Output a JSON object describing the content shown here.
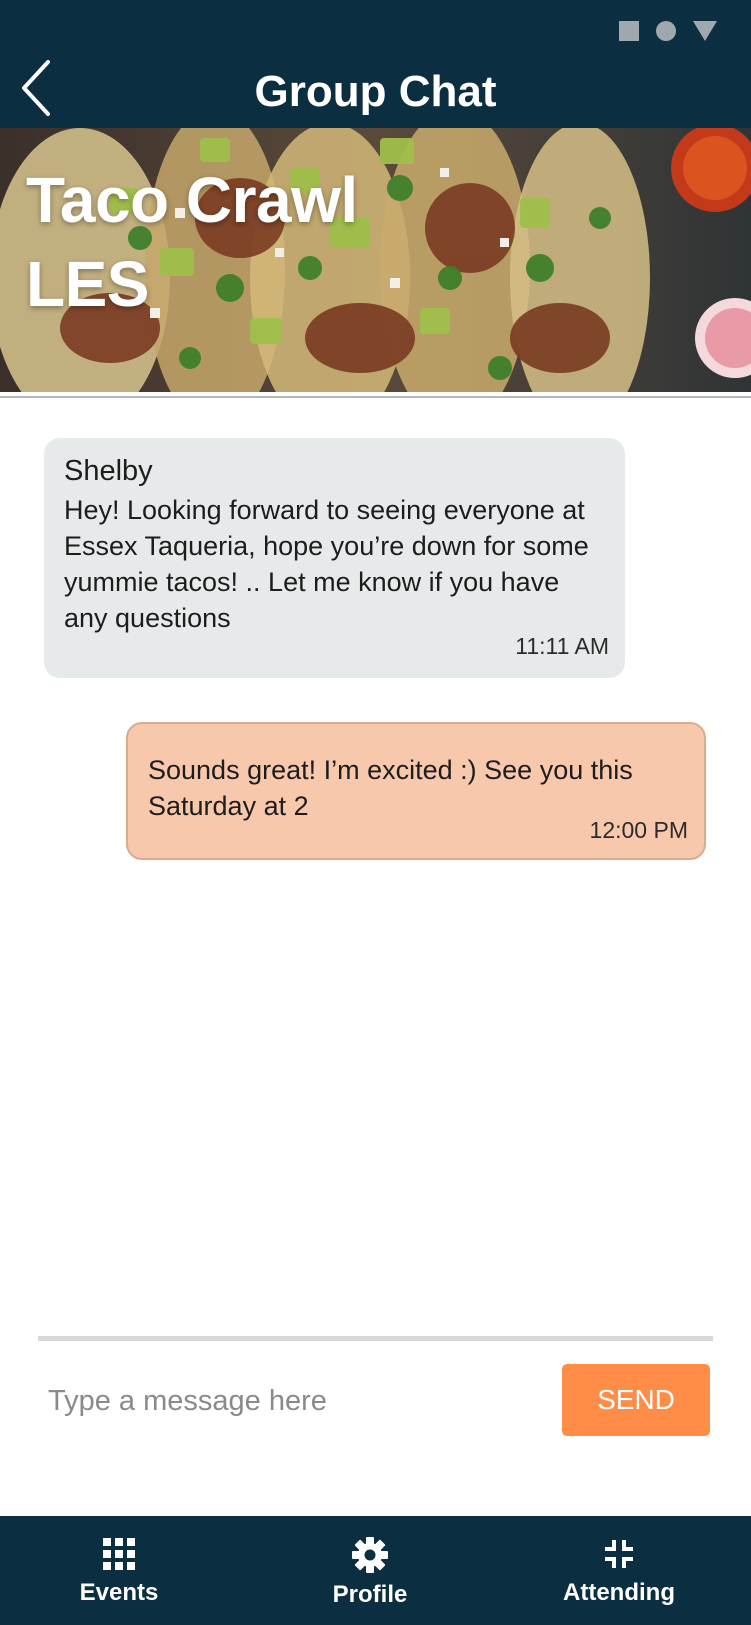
{
  "header": {
    "title": "Group Chat",
    "back_icon": "chevron-left-icon",
    "status_icons": [
      "square-icon",
      "circle-icon",
      "triangle-down-icon"
    ]
  },
  "event": {
    "title": "Taco Crawl LES"
  },
  "messages": [
    {
      "direction": "incoming",
      "sender": "Shelby",
      "text": "Hey! Looking forward to seeing everyone at Essex Taqueria, hope you’re down for some yummie tacos! ..  Let me know if you have any questions",
      "time": "11:11 AM"
    },
    {
      "direction": "outgoing",
      "text": "Sounds great! I’m excited :) See you this Saturday at 2",
      "time": "12:00 PM"
    }
  ],
  "composer": {
    "placeholder": "Type a message here",
    "send_label": "SEND"
  },
  "nav": {
    "items": [
      {
        "label": "Events",
        "icon": "grid-icon"
      },
      {
        "label": "Profile",
        "icon": "gear-icon"
      },
      {
        "label": "Attending",
        "icon": "collapse-icon"
      }
    ]
  },
  "colors": {
    "header_bg": "#0b2f40",
    "incoming_bubble": "#e7eaeb",
    "outgoing_bubble": "#f8c8ad",
    "accent": "#ff8d47"
  }
}
